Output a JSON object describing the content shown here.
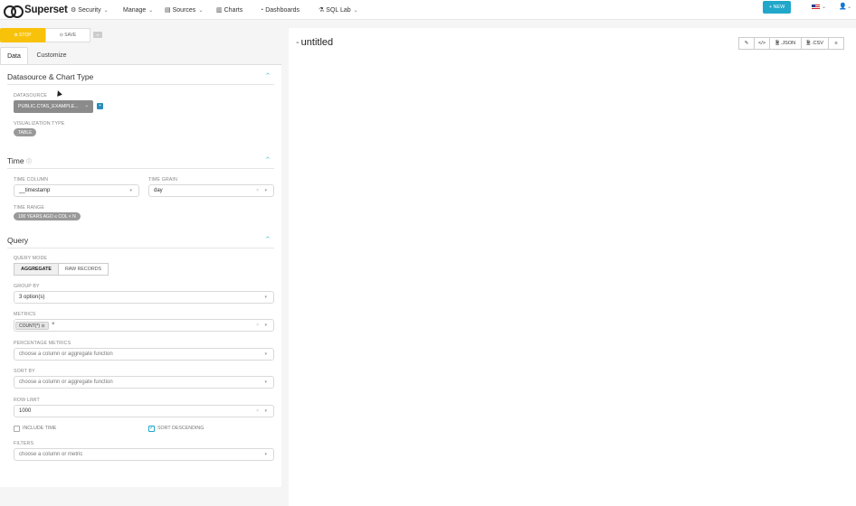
{
  "navbar": {
    "brand": "Superset",
    "items": [
      {
        "icon": "gear-icon",
        "label": "Security"
      },
      {
        "icon": "",
        "label": "Manage"
      },
      {
        "icon": "database-icon",
        "label": "Sources"
      },
      {
        "icon": "bar-chart-icon",
        "label": "Charts"
      },
      {
        "icon": "dashboard-icon",
        "label": "Dashboards"
      },
      {
        "icon": "flask-icon",
        "label": "SQL Lab"
      }
    ],
    "new_label": "+ NEW"
  },
  "toolbar": {
    "stop_label": "⊗ STOP",
    "save_label": "⊙ SAVE"
  },
  "tabs": [
    {
      "label": "Data"
    },
    {
      "label": "Customize"
    }
  ],
  "sections": {
    "datasource": {
      "title": "Datasource & Chart Type",
      "ds_label": "DATASOURCE",
      "ds_value": "PUBLIC.CTAS_EXAMPLE...",
      "viz_label": "VISUALIZATION TYPE",
      "viz_value": "TABLE"
    },
    "time": {
      "title": "Time",
      "col_label": "TIME COLUMN",
      "col_value": "__timestamp",
      "grain_label": "TIME GRAIN",
      "grain_value": "day",
      "range_label": "TIME RANGE",
      "range_value": "100 YEARS AGO ≤ COL < N"
    },
    "query": {
      "title": "Query",
      "mode_label": "QUERY MODE",
      "mode_aggregate": "AGGREGATE",
      "mode_raw": "RAW RECORDS",
      "groupby_label": "GROUP BY",
      "groupby_value": "3 option(s)",
      "metrics_label": "METRICS",
      "metrics_tag": "COUNT(*) ⊙",
      "pct_label": "PERCENTAGE METRICS",
      "pct_placeholder": "choose a column or aggregate function",
      "sortby_label": "SORT BY",
      "sortby_placeholder": "choose a column or aggregate function",
      "rowlimit_label": "ROW LIMIT",
      "rowlimit_value": "1000",
      "include_time": "INCLUDE TIME",
      "sort_desc": "SORT DESCENDING",
      "filters_label": "FILTERS",
      "filters_placeholder": "choose a column or metric"
    }
  },
  "chart": {
    "title": "untitled",
    "actions": [
      "✎",
      "</>",
      "🗎 .JSON",
      "🗎 .CSV",
      "≡"
    ]
  }
}
